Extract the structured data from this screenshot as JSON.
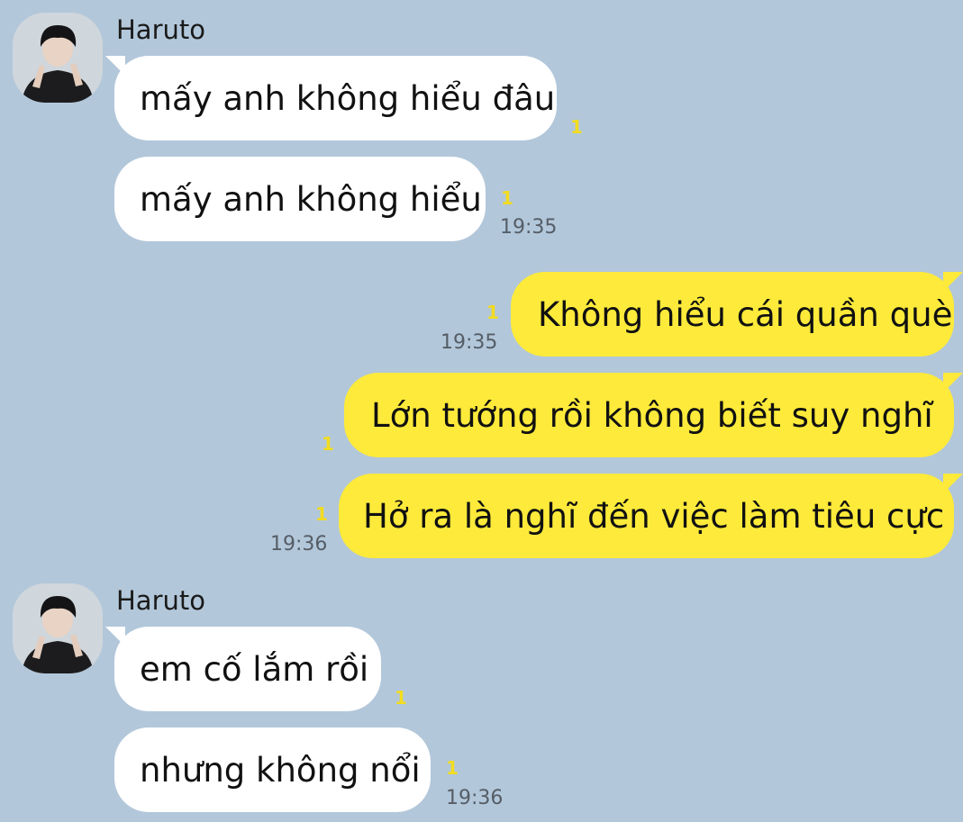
{
  "messages": [
    {
      "sender": "Haruto",
      "text": "mấy anh không hiểu đâu",
      "read": "1"
    },
    {
      "text": "mấy anh không hiểu",
      "read": "1",
      "time": "19:35"
    },
    {
      "text": "Không hiểu cái quần què",
      "read": "1",
      "time": "19:35"
    },
    {
      "text": "Lớn tướng rồi không biết suy nghĩ",
      "read": "1"
    },
    {
      "text": "Hở ra là nghĩ đến việc làm tiêu cực",
      "read": "1",
      "time": "19:36"
    },
    {
      "sender": "Haruto",
      "text": "em cố lắm rồi",
      "read": "1"
    },
    {
      "text": "nhưng không nổi",
      "read": "1",
      "time": "19:36"
    }
  ],
  "colors": {
    "background": "#b2c7da",
    "incoming_bubble": "#ffffff",
    "outgoing_bubble": "#fdea3a",
    "read_count": "#f2dc1f"
  }
}
